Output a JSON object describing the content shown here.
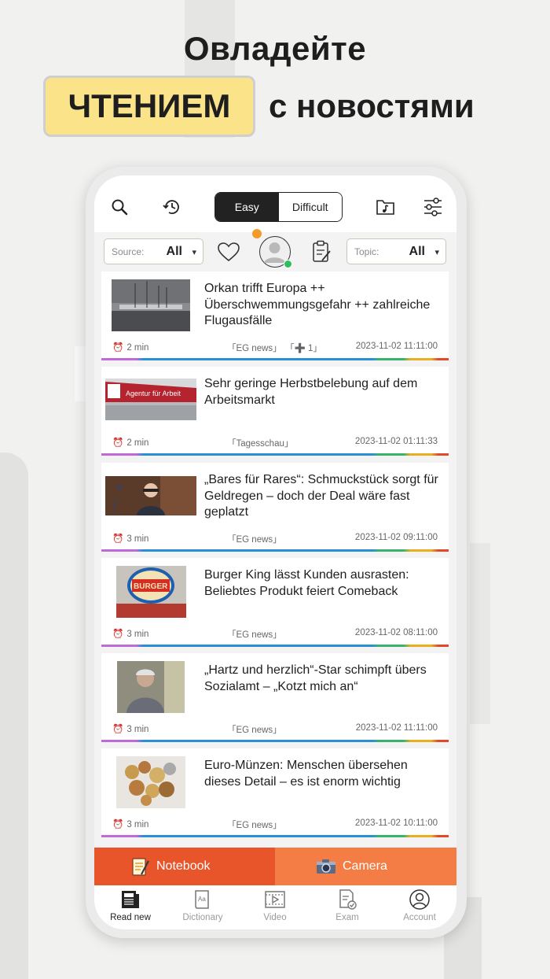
{
  "promo": {
    "line1": "Овладейте",
    "highlight": "ЧТЕНИЕМ",
    "line2_rest": "с новостями"
  },
  "toolbar": {
    "level_easy": "Easy",
    "level_difficult": "Difficult",
    "active_level": "Easy"
  },
  "filters": {
    "source_label": "Source:",
    "source_value": "All",
    "topic_label": "Topic:",
    "topic_value": "All"
  },
  "articles": [
    {
      "title": "Orkan trifft Europa ++ Überschwemmungsgefahr ++ zahlreiche Flugausfälle",
      "duration": "2 min",
      "source": "「EG news」",
      "rank": "「➕ 1」",
      "date": "2023-11-02 11:11:00",
      "thumb": "harbor-photo"
    },
    {
      "title": "Sehr geringe Herbstbelebung auf dem Arbeitsmarkt",
      "duration": "2 min",
      "source": "「Tagesschau」",
      "rank": "",
      "date": "2023-11-02 01:11:33",
      "thumb": "agentur-fuer-arbeit-photo"
    },
    {
      "title": "„Bares für Rares“: Schmuckstück sorgt für Geldregen – doch der Deal wäre fast geplatzt",
      "duration": "3 min",
      "source": "「EG news」",
      "rank": "",
      "date": "2023-11-02 09:11:00",
      "thumb": "tv-show-photo"
    },
    {
      "title": "Burger King lässt Kunden ausrasten: Beliebtes Produkt feiert Comeback",
      "duration": "3 min",
      "source": "「EG news」",
      "rank": "",
      "date": "2023-11-02 08:11:00",
      "thumb": "burger-king-sign-photo"
    },
    {
      "title": "„Hartz und herzlich“-Star schimpft übers Sozialamt – „Kotzt mich an“",
      "duration": "3 min",
      "source": "「EG news」",
      "rank": "",
      "date": "2023-11-02 11:11:00",
      "thumb": "woman-portrait-photo"
    },
    {
      "title": "Euro-Münzen: Menschen übersehen dieses Detail – es ist enorm wichtig",
      "duration": "3 min",
      "source": "「EG news」",
      "rank": "",
      "date": "2023-11-02 10:11:00",
      "thumb": "coins-photo"
    }
  ],
  "actions": {
    "notebook": "Notebook",
    "camera": "Camera"
  },
  "tabs": [
    {
      "label": "Read new",
      "icon": "newspaper-icon",
      "active": true
    },
    {
      "label": "Dictionary",
      "icon": "dictionary-icon",
      "active": false
    },
    {
      "label": "Video",
      "icon": "video-icon",
      "active": false
    },
    {
      "label": "Exam",
      "icon": "exam-icon",
      "active": false
    },
    {
      "label": "Account",
      "icon": "account-icon",
      "active": false
    }
  ],
  "colors": {
    "highlight_bg": "#fbe38a",
    "notebook_bg": "#e9552b",
    "camera_bg": "#f47d45",
    "online_dot": "#2fbf5a"
  }
}
